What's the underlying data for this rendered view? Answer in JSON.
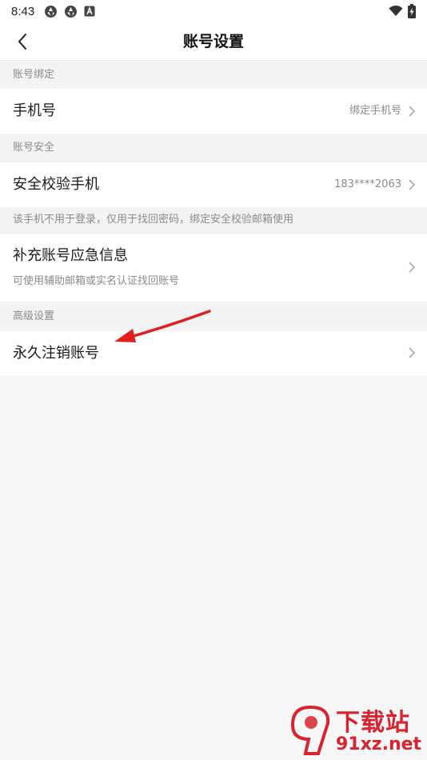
{
  "status_bar": {
    "time": "8:43",
    "left_icons": [
      "aperture-icon",
      "aperture-icon",
      "app-a-icon"
    ],
    "right_icons": [
      "wifi-icon",
      "battery-charging-icon"
    ]
  },
  "header": {
    "title": "账号设置",
    "back_icon": "chevron-left-icon"
  },
  "sections": {
    "binding": {
      "header": "账号绑定",
      "phone": {
        "title": "手机号",
        "value": "绑定手机号"
      }
    },
    "security": {
      "header": "账号安全",
      "verify_phone": {
        "title": "安全校验手机",
        "value": "183****2063"
      },
      "note": "该手机不用于登录，仅用于找回密码，绑定安全校验邮箱使用",
      "emergency": {
        "title": "补充账号应急信息",
        "subtitle": "可使用辅助邮箱或实名认证找回账号"
      }
    },
    "advanced": {
      "header": "高级设置",
      "delete_account": {
        "title": "永久注销账号"
      }
    }
  },
  "annotation": {
    "arrow_color": "#e02020"
  },
  "watermark": {
    "brand_text": "下载站",
    "domain_text": "91xz.net",
    "color": "#d9232e"
  },
  "colors": {
    "background": "#f7f7f7",
    "section_bg": "#f3f3f3",
    "text": "#1a1a1a",
    "muted": "#8a8a8a"
  }
}
